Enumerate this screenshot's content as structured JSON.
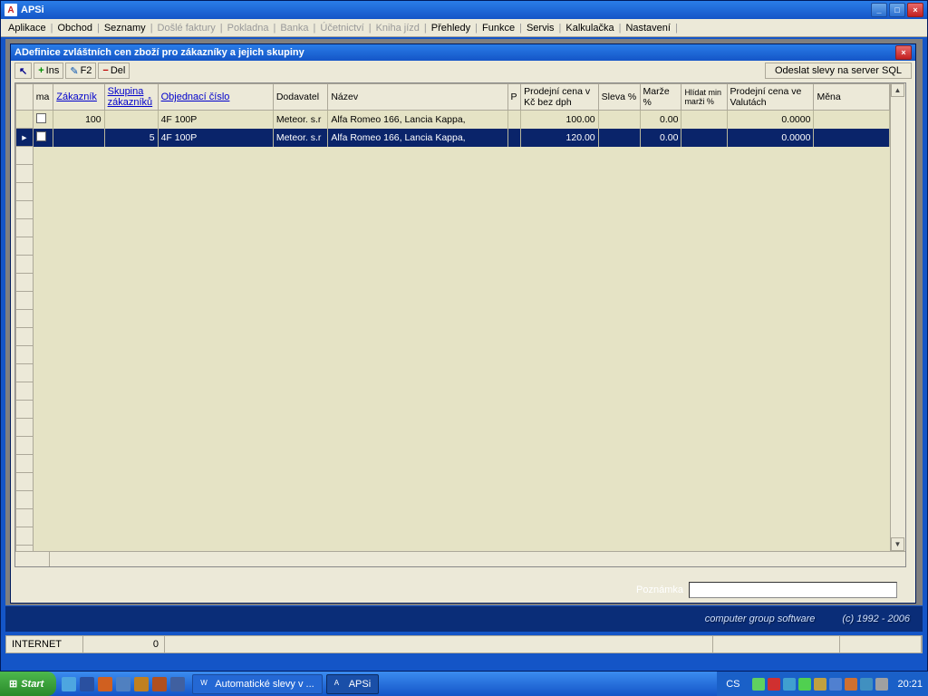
{
  "window": {
    "title": "APSi"
  },
  "menu": {
    "items": [
      "Aplikace",
      "Obchod",
      "Seznamy"
    ],
    "disabled": [
      "Došlé faktury",
      "Pokladna",
      "Banka",
      "Účetnictví",
      "Kniha jízd"
    ],
    "items2": [
      "Přehledy",
      "Funkce",
      "Servis",
      "Kalkulačka",
      "Nastavení"
    ]
  },
  "child": {
    "title": "Definice zvláštních cen zboží pro zákazníky a jejich skupiny",
    "toolbar": {
      "ins": "Ins",
      "f2": "F2",
      "del": "Del",
      "server": "Odeslat slevy na server SQL"
    },
    "columns": {
      "ma": "ma",
      "zakaznik": "Zákazník",
      "skupina": "Skupina zákazníků",
      "objednaci": "Objednací číslo",
      "dodavatel": "Dodavatel",
      "nazev": "Název",
      "p": "P",
      "prodejni": "Prodejní cena v Kč bez dph",
      "sleva": "Sleva %",
      "marze": "Marže %",
      "hlidat": "Hlídat min marži %",
      "prodejni_val": "Prodejní cena ve Valutách",
      "mena": "Měna"
    },
    "rows": [
      {
        "zakaznik": "100",
        "skupina": "",
        "objednaci": "4F 100P",
        "dodavatel": "Meteor. s.r",
        "nazev": "Alfa Romeo 166, Lancia Kappa,",
        "prodejni": "100.00",
        "marze": "0.00",
        "prodejni_val": "0.0000"
      },
      {
        "zakaznik": "",
        "skupina": "5",
        "objednaci": "4F 100P",
        "dodavatel": "Meteor. s.r",
        "nazev": "Alfa Romeo 166, Lancia Kappa,",
        "prodejni": "120.00",
        "marze": "0.00",
        "prodejni_val": "0.0000"
      }
    ],
    "poznamka_label": "Poznámka"
  },
  "brand": {
    "company": "computer group software",
    "copyright": "(c) 1992 - 2006"
  },
  "status": {
    "net": "INTERNET",
    "num": "0"
  },
  "taskbar": {
    "start": "Start",
    "tasks": [
      {
        "label": "Automatické slevy v ..."
      },
      {
        "label": "APSi"
      }
    ],
    "lang": "CS",
    "clock": "20:21"
  },
  "icon_colors": {
    "ql": [
      "#4da6e0",
      "#2a50a0",
      "#d06020",
      "#5080c0",
      "#c08020",
      "#b05020",
      "#4060a0"
    ],
    "tray": [
      "#60d060",
      "#d03030",
      "#40a0d0",
      "#50d050",
      "#c0a040",
      "#5080d0",
      "#d07030",
      "#4090c0",
      "#a0a0a0"
    ]
  }
}
